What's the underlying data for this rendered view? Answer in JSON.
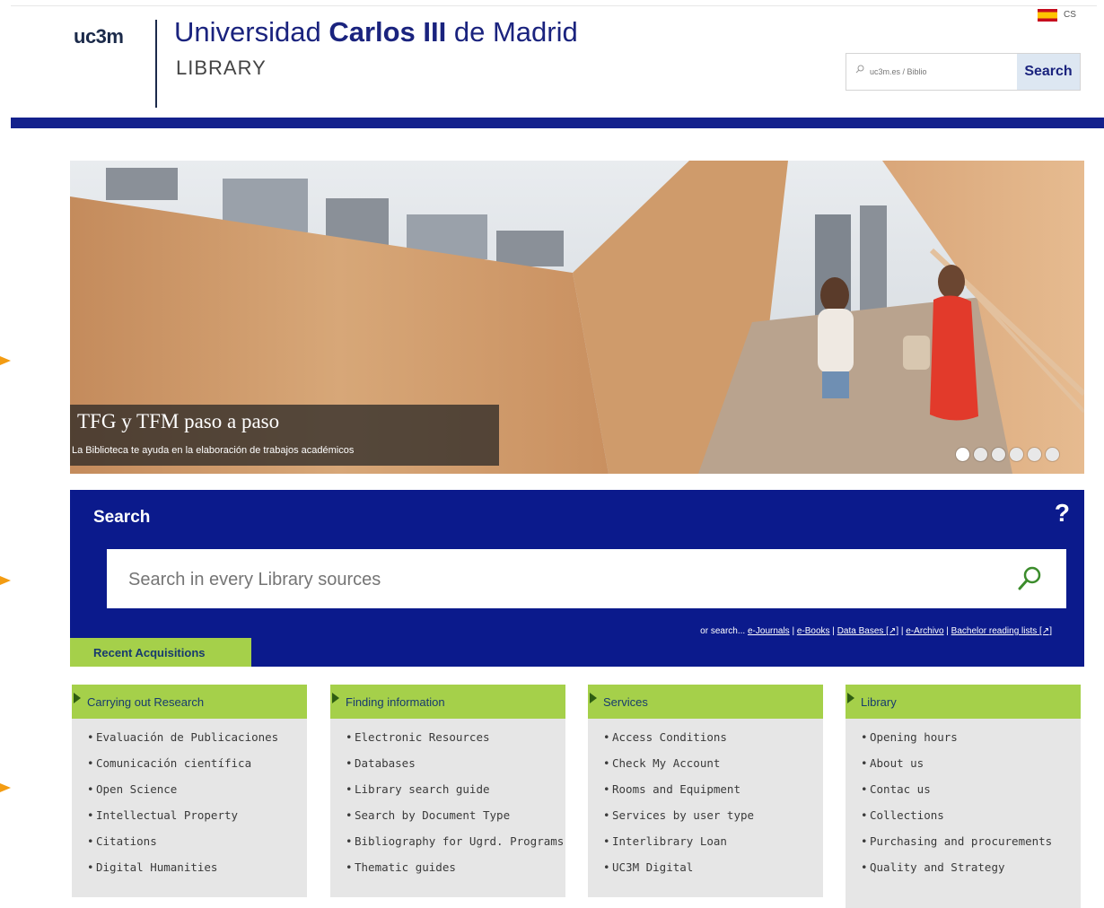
{
  "header": {
    "logo": "uc3m",
    "university_prefix": "Universidad ",
    "university_bold": "Carlos III",
    "university_suffix": " de Madrid",
    "library_label": "LIBRARY",
    "language_code": "CS",
    "search_placeholder": "uc3m.es / Biblio",
    "search_button": "Search"
  },
  "hero": {
    "title": "TFG y TFM paso a paso",
    "subtitle": "La Biblioteca te ayuda en la elaboración de trabajos académicos",
    "slide_count": 6,
    "active_slide": 1
  },
  "search": {
    "title": "Search",
    "help": "?",
    "placeholder": "Search in every Library sources",
    "or_search_label": "or search...",
    "links": [
      "e-Journals",
      "e-Books",
      "Data Bases [↗]",
      "e-Archivo",
      "Bachelor reading lists [↗]"
    ],
    "recent_tab": "Recent Acquisitions"
  },
  "columns": [
    {
      "title": "Carrying out Research",
      "items": [
        "Evaluación de Publicaciones",
        "Comunicación científica",
        "Open Science",
        "Intellectual Property",
        "Citations",
        "Digital Humanities"
      ]
    },
    {
      "title": "Finding information",
      "items": [
        "Electronic Resources",
        "Databases",
        "Library search guide",
        "Search by Document Type",
        "Bibliography for Ugrd. Programs",
        "Thematic guides"
      ]
    },
    {
      "title": "Services",
      "items": [
        "Access Conditions",
        "Check My Account",
        "Rooms and Equipment",
        "Services by user type",
        "Interlibrary Loan",
        "UC3M Digital"
      ]
    },
    {
      "title": "Library",
      "items": [
        "Opening hours",
        "About us",
        "Contac us",
        "Collections",
        "Purchasing and procurements",
        "Quality and Strategy"
      ]
    }
  ],
  "colors": {
    "navy": "#13218c",
    "search_panel": "#0b1a8c",
    "green": "#a5d04a",
    "arrow": "#f39c12"
  }
}
